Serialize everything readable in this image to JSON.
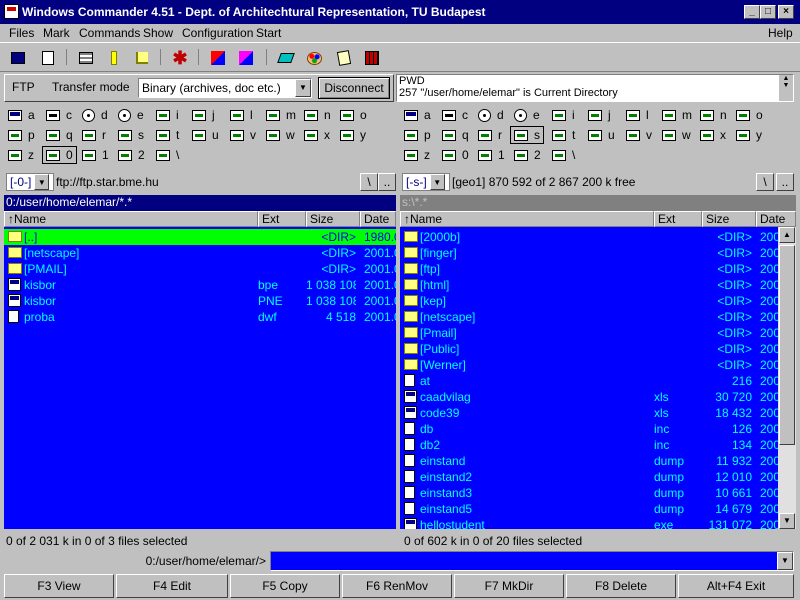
{
  "window": {
    "title": "Windows Commander 4.51 - Dept. of Architechtural Representation, TU Budapest"
  },
  "menu": {
    "items": [
      "Files",
      "Mark",
      "Commands",
      "Show",
      "Configuration",
      "Start"
    ],
    "help": "Help"
  },
  "toolbar": {
    "buttons": [
      "refresh-icon",
      "file-list-icon",
      "brief-view-icon",
      "full-view-icon",
      "tree-icon",
      "star-icon",
      "ftp-connect-icon",
      "ftp-disconnect-icon",
      "eraser-icon",
      "palette-icon",
      "notepad-icon",
      "multi-rename-icon"
    ]
  },
  "ftp": {
    "label": "FTP",
    "transfer_label": "Transfer mode",
    "transfer_mode": "Binary (archives, doc etc.)",
    "disconnect": "Disconnect",
    "log": [
      "PWD",
      "257 \"/user/home/elemar\" is Current Directory"
    ]
  },
  "drives": {
    "row1": [
      "a",
      "c",
      "d",
      "e",
      "i",
      "j",
      "l",
      "m",
      "n",
      "o"
    ],
    "row2": [
      "p",
      "q",
      "r",
      "s",
      "t",
      "u",
      "v",
      "w",
      "x",
      "y"
    ],
    "row3": [
      "z",
      "0",
      "1",
      "2",
      "\\"
    ]
  },
  "left": {
    "drive": "[-0-]",
    "location": "ftp://ftp.star.bme.hu",
    "root": "\\",
    "up": "..",
    "path": "0:/user/home/elemar/*.*",
    "columns": [
      "↑Name",
      "Ext",
      "Size",
      "Date"
    ],
    "files": [
      {
        "name": "[..]",
        "ext": "",
        "size": "<DIR>",
        "date": "1980.0",
        "icon": "up"
      },
      {
        "name": "[netscape]",
        "ext": "",
        "size": "<DIR>",
        "date": "2001.0",
        "icon": "folder"
      },
      {
        "name": "[PMAIL]",
        "ext": "",
        "size": "<DIR>",
        "date": "2001.0",
        "icon": "folder"
      },
      {
        "name": "kisbor",
        "ext": "bpe",
        "size": "1 038 108",
        "date": "2001.0",
        "icon": "exe"
      },
      {
        "name": "kisbor",
        "ext": "PNE",
        "size": "1 038 108",
        "date": "2001.0",
        "icon": "exe"
      },
      {
        "name": "proba",
        "ext": "dwf",
        "size": "4 518",
        "date": "2001.0",
        "icon": "doc"
      }
    ],
    "status": "0 of 2 031 k in 0 of 3 files selected"
  },
  "right": {
    "drive": "[-s-]",
    "location": "[geo1]  870 592 of 2 867 200 k free",
    "root": "\\",
    "up": "..",
    "path": "s:\\*.*",
    "columns": [
      "↑Name",
      "Ext",
      "Size",
      "Date"
    ],
    "files": [
      {
        "name": "[2000b]",
        "ext": "",
        "size": "<DIR>",
        "date": "200",
        "icon": "folder"
      },
      {
        "name": "[finger]",
        "ext": "",
        "size": "<DIR>",
        "date": "200",
        "icon": "folder"
      },
      {
        "name": "[ftp]",
        "ext": "",
        "size": "<DIR>",
        "date": "200",
        "icon": "folder"
      },
      {
        "name": "[html]",
        "ext": "",
        "size": "<DIR>",
        "date": "200",
        "icon": "folder"
      },
      {
        "name": "[kep]",
        "ext": "",
        "size": "<DIR>",
        "date": "200",
        "icon": "folder"
      },
      {
        "name": "[netscape]",
        "ext": "",
        "size": "<DIR>",
        "date": "200",
        "icon": "folder"
      },
      {
        "name": "[Pmail]",
        "ext": "",
        "size": "<DIR>",
        "date": "200",
        "icon": "folder"
      },
      {
        "name": "[Public]",
        "ext": "",
        "size": "<DIR>",
        "date": "200",
        "icon": "folder"
      },
      {
        "name": "[Werner]",
        "ext": "",
        "size": "<DIR>",
        "date": "200",
        "icon": "folder"
      },
      {
        "name": "at",
        "ext": "",
        "size": "216",
        "date": "200",
        "icon": "doc"
      },
      {
        "name": "caadvilag",
        "ext": "xls",
        "size": "30 720",
        "date": "200",
        "icon": "exe"
      },
      {
        "name": "code39",
        "ext": "xls",
        "size": "18 432",
        "date": "200",
        "icon": "exe"
      },
      {
        "name": "db",
        "ext": "inc",
        "size": "126",
        "date": "200",
        "icon": "doc"
      },
      {
        "name": "db2",
        "ext": "inc",
        "size": "134",
        "date": "200",
        "icon": "doc"
      },
      {
        "name": "einstand",
        "ext": "dump",
        "size": "11 932",
        "date": "200",
        "icon": "doc"
      },
      {
        "name": "einstand2",
        "ext": "dump",
        "size": "12 010",
        "date": "200",
        "icon": "doc"
      },
      {
        "name": "einstand3",
        "ext": "dump",
        "size": "10 661",
        "date": "200",
        "icon": "doc"
      },
      {
        "name": "einstand5",
        "ext": "dump",
        "size": "14 679",
        "date": "200",
        "icon": "doc"
      },
      {
        "name": "hellostudent",
        "ext": "exe",
        "size": "131 072",
        "date": "200",
        "icon": "exe"
      }
    ],
    "status": "0 of 602 k in 0 of 20 files selected"
  },
  "cmdline": {
    "prompt": "0:/user/home/elemar/>",
    "value": ""
  },
  "fkeys": [
    "F3 View",
    "F4 Edit",
    "F5 Copy",
    "F6 RenMov",
    "F7 MkDir",
    "F8 Delete",
    "Alt+F4 Exit"
  ],
  "colors": {
    "panel_bg": "#0000ff",
    "panel_text": "#00ffff",
    "cursor": "#00ff00",
    "title_bg": "#000080"
  }
}
